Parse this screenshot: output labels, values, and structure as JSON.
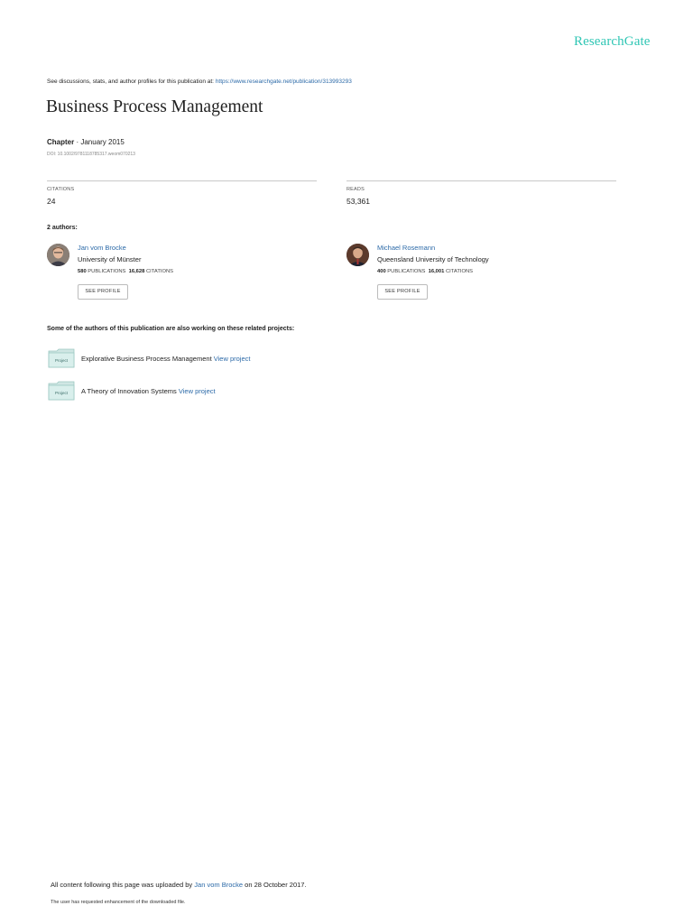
{
  "brand": {
    "logo_text": "ResearchGate",
    "accent": "#2fc6b4",
    "link_color": "#2c6aa8"
  },
  "header": {
    "see_discussions": "See discussions, stats, and author profiles for this publication at:",
    "url": "https://www.researchgate.net/publication/313993293"
  },
  "publication": {
    "title": "Business Process Management",
    "type": "Chapter",
    "separator": " · ",
    "date": "January 2015",
    "doi": "DOI: 10.1002/9781118785317.weom070213"
  },
  "stats": {
    "citations_label": "CITATIONS",
    "citations_value": "24",
    "reads_label": "READS",
    "reads_value": "53,361"
  },
  "authors_heading": "2 authors:",
  "authors": [
    {
      "name": "Jan vom Brocke",
      "institution": "University of Münster",
      "publications": "580",
      "publications_label": "PUBLICATIONS",
      "citations": "16,628",
      "citations_label": "CITATIONS",
      "button": "SEE PROFILE"
    },
    {
      "name": "Michael Rosemann",
      "institution": "Queensland University of Technology",
      "publications": "400",
      "publications_label": "PUBLICATIONS",
      "citations": "16,001",
      "citations_label": "CITATIONS",
      "button": "SEE PROFILE"
    }
  ],
  "projects_heading": "Some of the authors of this publication are also working on these related projects:",
  "projects": [
    {
      "folder_label": "Project",
      "title": "Explorative Business Process Management",
      "link": "View project"
    },
    {
      "folder_label": "Project",
      "title": "A Theory of Innovation Systems",
      "link": "View project"
    }
  ],
  "footer": {
    "uploaded_prefix": "All content following this page was uploaded by",
    "uploader": "Jan vom Brocke",
    "uploaded_suffix": "on 28 October 2017.",
    "note": "The user has requested enhancement of the downloaded file."
  },
  "icons": {
    "folder": "project-folder-icon",
    "avatar": "author-avatar"
  }
}
